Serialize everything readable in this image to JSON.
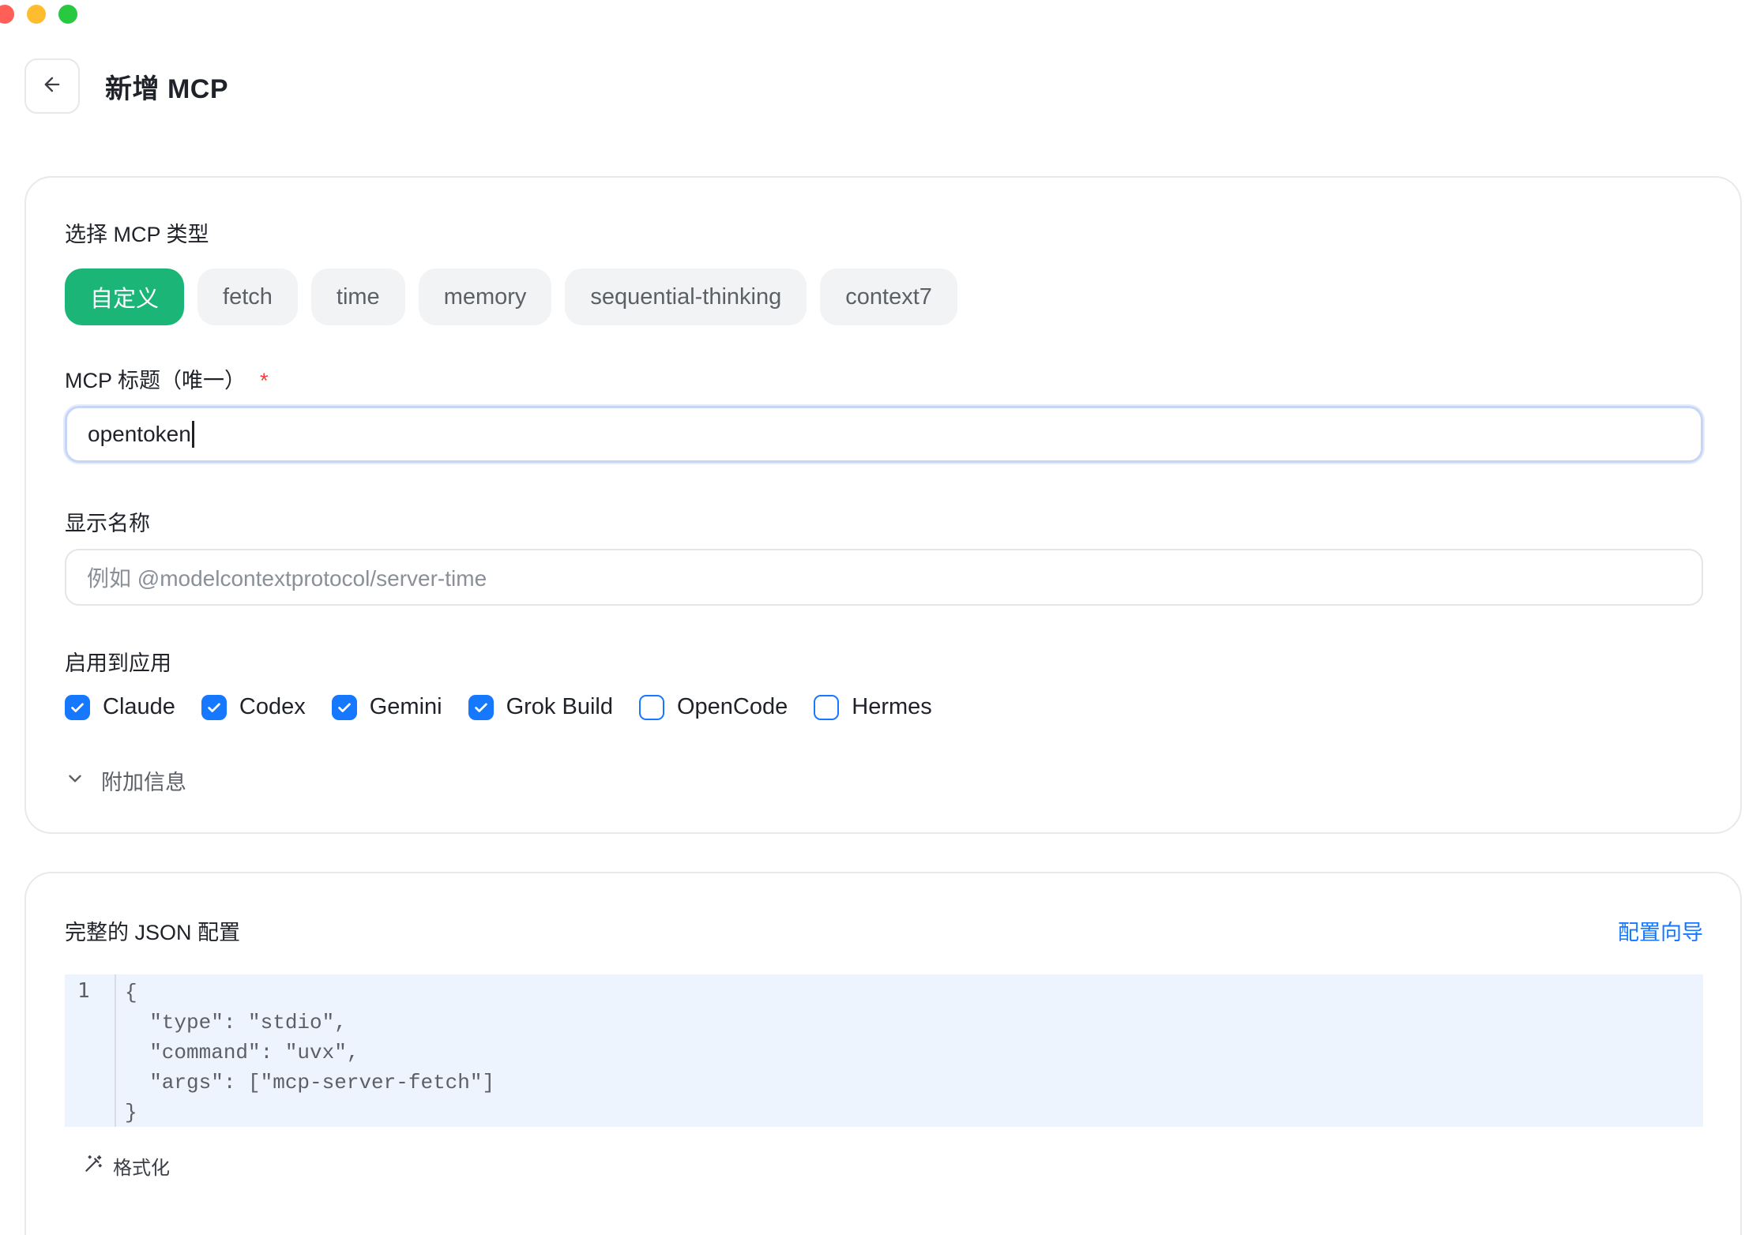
{
  "window": {
    "title": "新增 MCP"
  },
  "type_section": {
    "label": "选择 MCP 类型",
    "chips": [
      {
        "label": "自定义",
        "selected": true
      },
      {
        "label": "fetch",
        "selected": false
      },
      {
        "label": "time",
        "selected": false
      },
      {
        "label": "memory",
        "selected": false
      },
      {
        "label": "sequential-thinking",
        "selected": false
      },
      {
        "label": "context7",
        "selected": false
      }
    ]
  },
  "title_field": {
    "label": "MCP 标题（唯一）",
    "required_mark": "*",
    "value": "opentoken"
  },
  "display_name_field": {
    "label": "显示名称",
    "placeholder": "例如 @modelcontextprotocol/server-time"
  },
  "apps_section": {
    "label": "启用到应用",
    "apps": [
      {
        "label": "Claude",
        "checked": true
      },
      {
        "label": "Codex",
        "checked": true
      },
      {
        "label": "Gemini",
        "checked": true
      },
      {
        "label": "Grok Build",
        "checked": true
      },
      {
        "label": "OpenCode",
        "checked": false
      },
      {
        "label": "Hermes",
        "checked": false
      }
    ]
  },
  "extra_info": {
    "label": "附加信息"
  },
  "json_section": {
    "label": "完整的 JSON 配置",
    "wizard_link": "配置向导",
    "line_number": "1",
    "code": "{\n  \"type\": \"stdio\",\n  \"command\": \"uvx\",\n  \"args\": [\"mcp-server-fetch\"]\n}",
    "format_label": "格式化"
  },
  "colors": {
    "accent_green": "#1bb578",
    "checkbox_blue": "#1677ff",
    "link_blue": "#1677ff",
    "required_red": "#f03e3e",
    "editor_bg": "#eef4fd"
  }
}
